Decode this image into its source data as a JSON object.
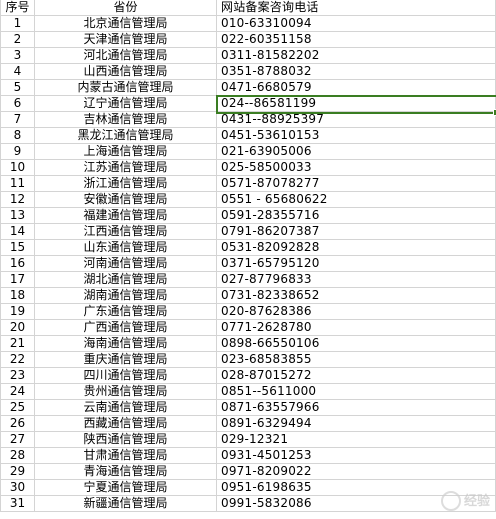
{
  "header": {
    "num": "序号",
    "province": "省份",
    "phone": "网站备案咨询电话"
  },
  "rows": [
    {
      "num": "1",
      "province": "北京通信管理局",
      "phone": "010-63310094"
    },
    {
      "num": "2",
      "province": "天津通信管理局",
      "phone": "022-60351158"
    },
    {
      "num": "3",
      "province": "河北通信管理局",
      "phone": "0311-81582202"
    },
    {
      "num": "4",
      "province": "山西通信管理局",
      "phone": "0351-8788032"
    },
    {
      "num": "5",
      "province": "内蒙古通信管理局",
      "phone": "0471-6680579"
    },
    {
      "num": "6",
      "province": "辽宁通信管理局",
      "phone": "024--86581199"
    },
    {
      "num": "7",
      "province": "吉林通信管理局",
      "phone": "0431--88925397"
    },
    {
      "num": "8",
      "province": "黑龙江通信管理局",
      "phone": "0451-53610153"
    },
    {
      "num": "9",
      "province": "上海通信管理局",
      "phone": "021-63905006"
    },
    {
      "num": "10",
      "province": "江苏通信管理局",
      "phone": "025-58500033"
    },
    {
      "num": "11",
      "province": "浙江通信管理局",
      "phone": "0571-87078277"
    },
    {
      "num": "12",
      "province": "安徽通信管理局",
      "phone": "0551 - 65680622"
    },
    {
      "num": "13",
      "province": "福建通信管理局",
      "phone": "0591-28355716"
    },
    {
      "num": "14",
      "province": "江西通信管理局",
      "phone": "0791-86207387"
    },
    {
      "num": "15",
      "province": "山东通信管理局",
      "phone": "0531-82092828"
    },
    {
      "num": "16",
      "province": "河南通信管理局",
      "phone": "0371-65795120"
    },
    {
      "num": "17",
      "province": "湖北通信管理局",
      "phone": "027-87796833"
    },
    {
      "num": "18",
      "province": "湖南通信管理局",
      "phone": "0731-82338652"
    },
    {
      "num": "19",
      "province": "广东通信管理局",
      "phone": "020-87628386"
    },
    {
      "num": "20",
      "province": "广西通信管理局",
      "phone": "0771-2628780"
    },
    {
      "num": "21",
      "province": "海南通信管理局",
      "phone": "0898-66550106"
    },
    {
      "num": "22",
      "province": "重庆通信管理局",
      "phone": "023-68583855"
    },
    {
      "num": "23",
      "province": "四川通信管理局",
      "phone": "028-87015272"
    },
    {
      "num": "24",
      "province": "贵州通信管理局",
      "phone": "0851--5611000"
    },
    {
      "num": "25",
      "province": "云南通信管理局",
      "phone": "0871-63557966"
    },
    {
      "num": "26",
      "province": "西藏通信管理局",
      "phone": "0891-6329494"
    },
    {
      "num": "27",
      "province": "陕西通信管理局",
      "phone": "029-12321"
    },
    {
      "num": "28",
      "province": "甘肃通信管理局",
      "phone": "0931-4501253"
    },
    {
      "num": "29",
      "province": "青海通信管理局",
      "phone": "0971-8209022"
    },
    {
      "num": "30",
      "province": "宁夏通信管理局",
      "phone": "0951-6198635"
    },
    {
      "num": "31",
      "province": "新疆通信管理局",
      "phone": "0991-5832086"
    }
  ],
  "selected_row_index": 5,
  "watermark": {
    "text": "经验",
    "icon": "baidu-jingyan-logo"
  },
  "colors": {
    "grid": "#d4d4d4",
    "selection": "#3a7d22"
  }
}
